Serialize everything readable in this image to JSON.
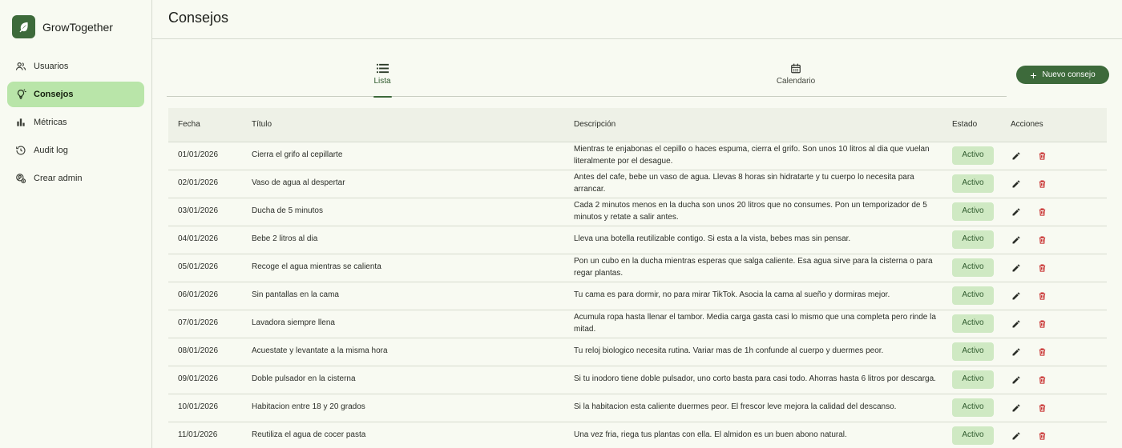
{
  "app": {
    "name": "GrowTogether",
    "logo_icon": "leaf-icon",
    "accent": "#3d6a3b"
  },
  "sidebar": {
    "items": [
      {
        "label": "Usuarios",
        "icon": "users-icon",
        "active": false
      },
      {
        "label": "Consejos",
        "icon": "lightbulb-icon",
        "active": true
      },
      {
        "label": "Métricas",
        "icon": "bar-chart-icon",
        "active": false
      },
      {
        "label": "Audit log",
        "icon": "history-icon",
        "active": false
      },
      {
        "label": "Crear admin",
        "icon": "add-admin-icon",
        "active": false
      }
    ]
  },
  "header": {
    "title": "Consejos"
  },
  "tabs": [
    {
      "label": "Lista",
      "icon": "list-icon",
      "active": true
    },
    {
      "label": "Calendario",
      "icon": "calendar-icon",
      "active": false
    }
  ],
  "actions": {
    "new_label": "Nuevo consejo"
  },
  "table": {
    "columns": [
      "Fecha",
      "Título",
      "Descripción",
      "Estado",
      "Acciones"
    ],
    "rows": [
      {
        "date": "01/01/2026",
        "title": "Cierra el grifo al cepillarte",
        "description": "Mientras te enjabonas el cepillo o haces espuma, cierra el grifo. Son unos 10 litros al dia que vuelan literalmente por el desague.",
        "status": "Activo"
      },
      {
        "date": "02/01/2026",
        "title": "Vaso de agua al despertar",
        "description": "Antes del cafe, bebe un vaso de agua. Llevas 8 horas sin hidratarte y tu cuerpo lo necesita para arrancar.",
        "status": "Activo"
      },
      {
        "date": "03/01/2026",
        "title": "Ducha de 5 minutos",
        "description": "Cada 2 minutos menos en la ducha son unos 20 litros que no consumes. Pon un temporizador de 5 minutos y retate a salir antes.",
        "status": "Activo"
      },
      {
        "date": "04/01/2026",
        "title": "Bebe 2 litros al dia",
        "description": "Lleva una botella reutilizable contigo. Si esta a la vista, bebes mas sin pensar.",
        "status": "Activo"
      },
      {
        "date": "05/01/2026",
        "title": "Recoge el agua mientras se calienta",
        "description": "Pon un cubo en la ducha mientras esperas que salga caliente. Esa agua sirve para la cisterna o para regar plantas.",
        "status": "Activo"
      },
      {
        "date": "06/01/2026",
        "title": "Sin pantallas en la cama",
        "description": "Tu cama es para dormir, no para mirar TikTok. Asocia la cama al sueño y dormiras mejor.",
        "status": "Activo"
      },
      {
        "date": "07/01/2026",
        "title": "Lavadora siempre llena",
        "description": "Acumula ropa hasta llenar el tambor. Media carga gasta casi lo mismo que una completa pero rinde la mitad.",
        "status": "Activo"
      },
      {
        "date": "08/01/2026",
        "title": "Acuestate y levantate a la misma hora",
        "description": "Tu reloj biologico necesita rutina. Variar mas de 1h confunde al cuerpo y duermes peor.",
        "status": "Activo"
      },
      {
        "date": "09/01/2026",
        "title": "Doble pulsador en la cisterna",
        "description": "Si tu inodoro tiene doble pulsador, uno corto basta para casi todo. Ahorras hasta 6 litros por descarga.",
        "status": "Activo"
      },
      {
        "date": "10/01/2026",
        "title": "Habitacion entre 18 y 20 grados",
        "description": "Si la habitacion esta caliente duermes peor. El frescor leve mejora la calidad del descanso.",
        "status": "Activo"
      },
      {
        "date": "11/01/2026",
        "title": "Reutiliza el agua de cocer pasta",
        "description": "Una vez fria, riega tus plantas con ella. El almidon es un buen abono natural.",
        "status": "Activo"
      }
    ],
    "row_actions": {
      "edit_icon": "pencil-icon",
      "delete_icon": "trash-icon",
      "delete_color": "#c62828"
    }
  }
}
